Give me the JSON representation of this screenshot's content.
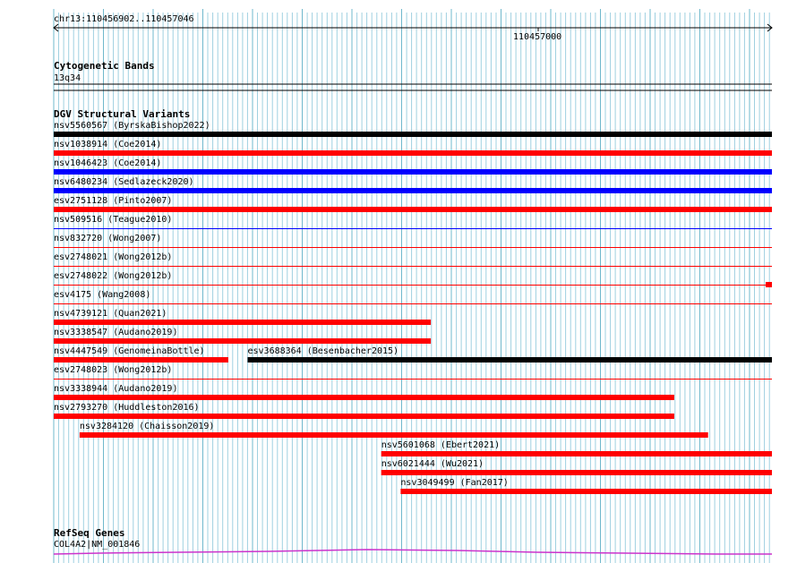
{
  "ruler": {
    "region": "chr13:110456902..110457046",
    "tick_label": "110457000"
  },
  "tracks": {
    "cytogenetic": {
      "title": "Cytogenetic Bands",
      "band": "13q34"
    },
    "dgv": {
      "title": "DGV Structural Variants",
      "features": [
        {
          "label": "nsv5560567 (ByrskaBishop2022)",
          "color": "#000000",
          "thick": true,
          "row": 0
        },
        {
          "label": "nsv1038914 (Coe2014)",
          "color": "#ff0000",
          "thick": true,
          "row": 1
        },
        {
          "label": "nsv1046423 (Coe2014)",
          "color": "#0000ff",
          "thick": true,
          "row": 2
        },
        {
          "label": "nsv6480234 (Sedlazeck2020)",
          "color": "#0000ff",
          "thick": true,
          "row": 3
        },
        {
          "label": "esv2751128 (Pinto2007)",
          "color": "#ff0000",
          "thick": true,
          "row": 4
        },
        {
          "label": "nsv509516 (Teague2010)",
          "color": "#0000ff",
          "thick": false,
          "row": 5
        },
        {
          "label": "nsv832720 (Wong2007)",
          "color": "#ff0000",
          "thick": false,
          "row": 6
        },
        {
          "label": "esv2748021 (Wong2012b)",
          "color": "#ff0000",
          "thick": false,
          "row": 7
        },
        {
          "label": "esv2748022 (Wong2012b)",
          "color": "#ff0000",
          "thick": false,
          "row": 8,
          "end_block": true
        },
        {
          "label": "esv4175 (Wang2008)",
          "color": "#ff0000",
          "thick": false,
          "row": 9
        },
        {
          "label": "nsv4739121 (Quan2021)",
          "color": "#ff0000",
          "thick": true,
          "row": 10,
          "end_frac": 0.525
        },
        {
          "label": "nsv3338547 (Audano2019)",
          "color": "#ff0000",
          "thick": true,
          "row": 11,
          "end_frac": 0.525
        },
        {
          "label": "nsv4447549 (GenomeinaBottle)",
          "color": "#ff0000",
          "thick": true,
          "row": 12,
          "end_frac": 0.243
        },
        {
          "label": "esv3688364 (Besenbacher2015)",
          "color": "#000000",
          "thick": true,
          "row": 12,
          "start_frac": 0.27
        },
        {
          "label": "esv2748023 (Wong2012b)",
          "color": "#ff0000",
          "thick": false,
          "row": 13
        },
        {
          "label": "nsv3338944 (Audano2019)",
          "color": "#ff0000",
          "thick": true,
          "row": 14,
          "end_frac": 0.864
        },
        {
          "label": "nsv2793270 (Huddleston2016)",
          "color": "#ff0000",
          "thick": true,
          "row": 15,
          "end_frac": 0.864
        },
        {
          "label": "nsv3284120 (Chaisson2019)",
          "color": "#ff0000",
          "thick": true,
          "row": 16,
          "start_frac": 0.036,
          "end_frac": 0.911
        },
        {
          "label": "nsv5601068 (Ebert2021)",
          "color": "#ff0000",
          "thick": true,
          "row": 17,
          "start_frac": 0.456
        },
        {
          "label": "nsv6021444 (Wu2021)",
          "color": "#ff0000",
          "thick": true,
          "row": 18,
          "start_frac": 0.456
        },
        {
          "label": "nsv3049499 (Fan2017)",
          "color": "#ff0000",
          "thick": true,
          "row": 19,
          "start_frac": 0.483
        }
      ]
    },
    "refseq": {
      "title": "RefSeq Genes",
      "gene": "COL4A2|NM_001846",
      "color": "#cc33cc"
    }
  },
  "colors": {
    "grid": "#9fd0e0",
    "grid_major": "#6fb8cc"
  }
}
